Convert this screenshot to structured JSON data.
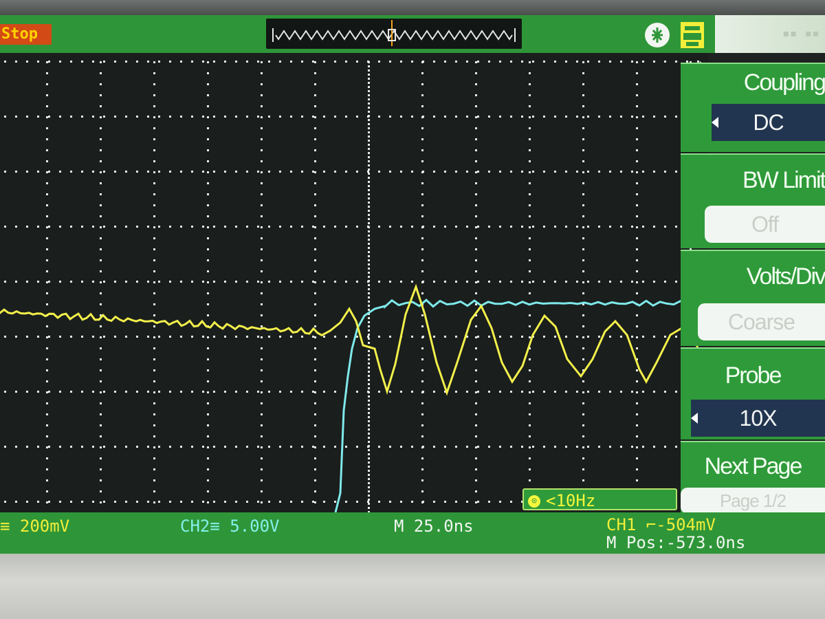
{
  "status": {
    "run_state": "Stop"
  },
  "trigger_icon": "trigger-marker-icon",
  "status_icons": [
    "usb-icon",
    "printer-icon"
  ],
  "menu": {
    "items": [
      {
        "title": "Coupling",
        "value": "DC",
        "style": "dark",
        "has_arrow": true
      },
      {
        "title": "BW Limit",
        "value": "Off",
        "style": "light",
        "has_arrow": false
      },
      {
        "title": "Volts/Div",
        "value": "Coarse",
        "style": "light",
        "has_arrow": false
      },
      {
        "title": "Probe",
        "value": "10X",
        "style": "dark",
        "has_arrow": true
      },
      {
        "title": "Next Page",
        "value": "Page 1/2",
        "style": "light",
        "has_arrow": false
      }
    ]
  },
  "bottom": {
    "ch1_scale": "≡ 200mV",
    "ch2_scale": "CH2≡ 5.00V",
    "timebase": "M 25.0ns",
    "trigger": "CH1 ⌐-504mV",
    "mpos": "M Pos:-573.0ns"
  },
  "frequency_readout": "<10Hz",
  "colors": {
    "ch1_trace": "#f2f04a",
    "ch2_trace": "#7fe9ea",
    "menu_green": "#2f9a3a",
    "bar_green": "#2e9638"
  }
}
